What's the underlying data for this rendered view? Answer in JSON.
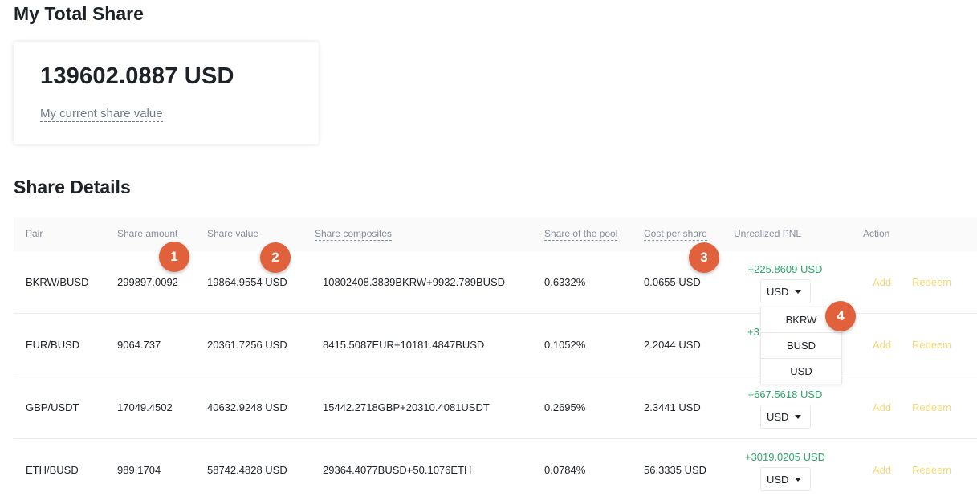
{
  "total": {
    "heading": "My Total Share",
    "value": "139602.0887 USD",
    "value_label": "My current share value"
  },
  "details": {
    "heading": "Share Details",
    "columns": {
      "pair": "Pair",
      "share_amount": "Share amount",
      "share_value": "Share value",
      "share_composites": "Share composites",
      "share_of_pool": "Share of the pool",
      "cost_per_share": "Cost per share",
      "unrealized_pnl": "Unrealized PNL",
      "action": "Action"
    },
    "rows": [
      {
        "pair": "BKRW/BUSD",
        "share_amount": "299897.0092",
        "share_value": "19864.9554 USD",
        "share_composites": "10802408.3839BKRW+9932.789BUSD",
        "share_of_pool": "0.6332%",
        "cost_per_share": "0.0655 USD",
        "pnl": "+225.8609 USD",
        "currency": "USD",
        "add": "Add",
        "redeem": "Redeem"
      },
      {
        "pair": "EUR/BUSD",
        "share_amount": "9064.737",
        "share_value": "20361.7256 USD",
        "share_composites": "8415.5087EUR+10181.4847BUSD",
        "share_of_pool": "0.1052%",
        "cost_per_share": "2.2044 USD",
        "pnl": "+3",
        "currency": "",
        "add": "Add",
        "redeem": "Redeem"
      },
      {
        "pair": "GBP/USDT",
        "share_amount": "17049.4502",
        "share_value": "40632.9248 USD",
        "share_composites": "15442.2718GBP+20310.4081USDT",
        "share_of_pool": "0.2695%",
        "cost_per_share": "2.3441 USD",
        "pnl": "+667.5618 USD",
        "currency": "USD",
        "add": "Add",
        "redeem": "Redeem"
      },
      {
        "pair": "ETH/BUSD",
        "share_amount": "989.1704",
        "share_value": "58742.4828 USD",
        "share_composites": "29364.4077BUSD+50.1076ETH",
        "share_of_pool": "0.0784%",
        "cost_per_share": "56.3335 USD",
        "pnl": "+3019.0205 USD",
        "currency": "USD",
        "add": "Add",
        "redeem": "Redeem"
      }
    ]
  },
  "currency_dropdown": {
    "options": [
      "BKRW",
      "BUSD",
      "USD"
    ]
  },
  "annotations": [
    "1",
    "2",
    "3",
    "4"
  ],
  "colors": {
    "positive": "#2ea56a",
    "action": "#f0b90b",
    "badge": "#e0613b"
  }
}
